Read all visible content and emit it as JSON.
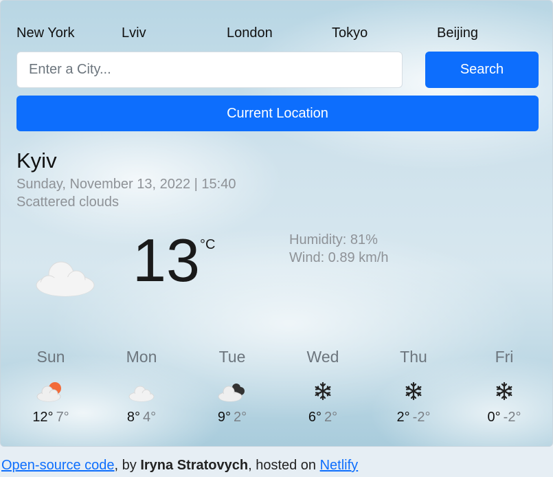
{
  "cities": [
    "New York",
    "Lviv",
    "London",
    "Tokyo",
    "Beijing"
  ],
  "search": {
    "placeholder": "Enter a City...",
    "button_label": "Search"
  },
  "location_button_label": "Current Location",
  "current": {
    "city": "Kyiv",
    "datetime": "Sunday, November 13, 2022 | 15:40",
    "description": "Scattered clouds",
    "icon": "cloud-icon",
    "temperature": "13",
    "unit": "°C",
    "humidity": "Humidity: 81%",
    "wind": "Wind: 0.89 km/h"
  },
  "forecast": [
    {
      "day": "Sun",
      "icon": "cloud-sun-icon",
      "max": "12°",
      "min": "7°"
    },
    {
      "day": "Mon",
      "icon": "cloud-icon",
      "max": "8°",
      "min": "4°"
    },
    {
      "day": "Tue",
      "icon": "dark-clouds-icon",
      "max": "9°",
      "min": "2°"
    },
    {
      "day": "Wed",
      "icon": "snowflake-icon",
      "max": "6°",
      "min": "2°"
    },
    {
      "day": "Thu",
      "icon": "snowflake-icon",
      "max": "2°",
      "min": "-2°"
    },
    {
      "day": "Fri",
      "icon": "snowflake-icon",
      "max": "0°",
      "min": "-2°"
    }
  ],
  "footer": {
    "source_link": "Open-source code",
    "by_text": ", by ",
    "author": "Iryna Stratovych",
    "hosted_text": ", hosted on ",
    "host_link": "Netlify"
  },
  "colors": {
    "accent": "#0d6efd",
    "muted_text": "#8e9297",
    "sun": "#f26b3a"
  }
}
